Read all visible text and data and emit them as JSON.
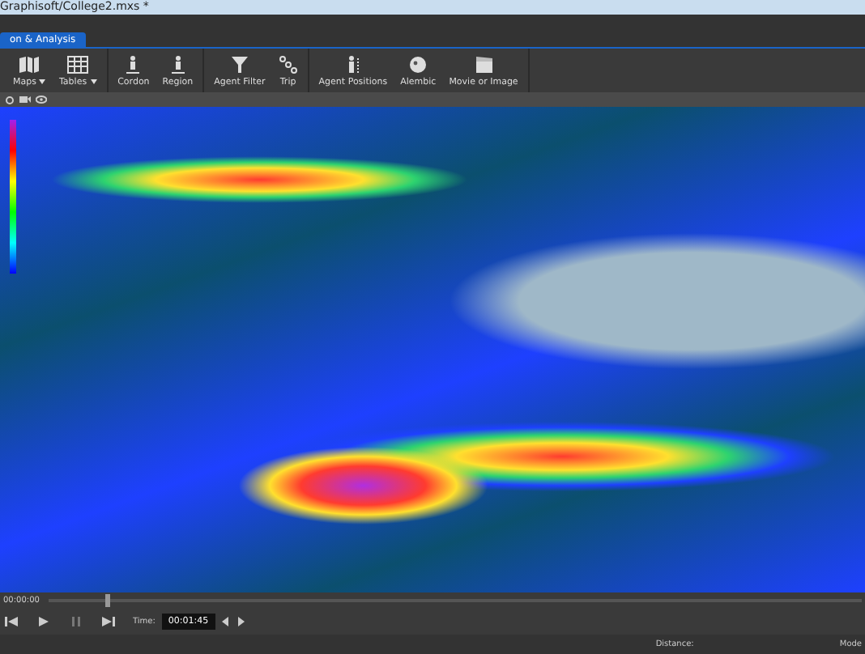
{
  "window": {
    "title": "Graphisoft/College2.mxs *"
  },
  "tabs": [
    {
      "label": "on & Analysis",
      "selected": true
    }
  ],
  "toolbar_groups": [
    {
      "items": [
        {
          "label": "Maps",
          "dropdown": true
        },
        {
          "label": "Tables",
          "dropdown": true
        }
      ]
    },
    {
      "items": [
        {
          "label": "Cordon",
          "dropdown": false
        },
        {
          "label": "Region",
          "dropdown": false
        }
      ]
    },
    {
      "items": [
        {
          "label": "Agent Filter",
          "dropdown": false
        },
        {
          "label": "Trip",
          "dropdown": false
        }
      ]
    },
    {
      "items": [
        {
          "label": "Agent Positions",
          "dropdown": false
        },
        {
          "label": "Alembic",
          "dropdown": false
        },
        {
          "label": "Movie or Image",
          "dropdown": false
        }
      ]
    }
  ],
  "timeline": {
    "start": "00:00:00",
    "level": 0.07
  },
  "playback": {
    "time_label": "Time:",
    "time_value": "00:01:45"
  },
  "status_bar": {
    "distance_label": "Distance:",
    "mode_label": "Mode"
  }
}
